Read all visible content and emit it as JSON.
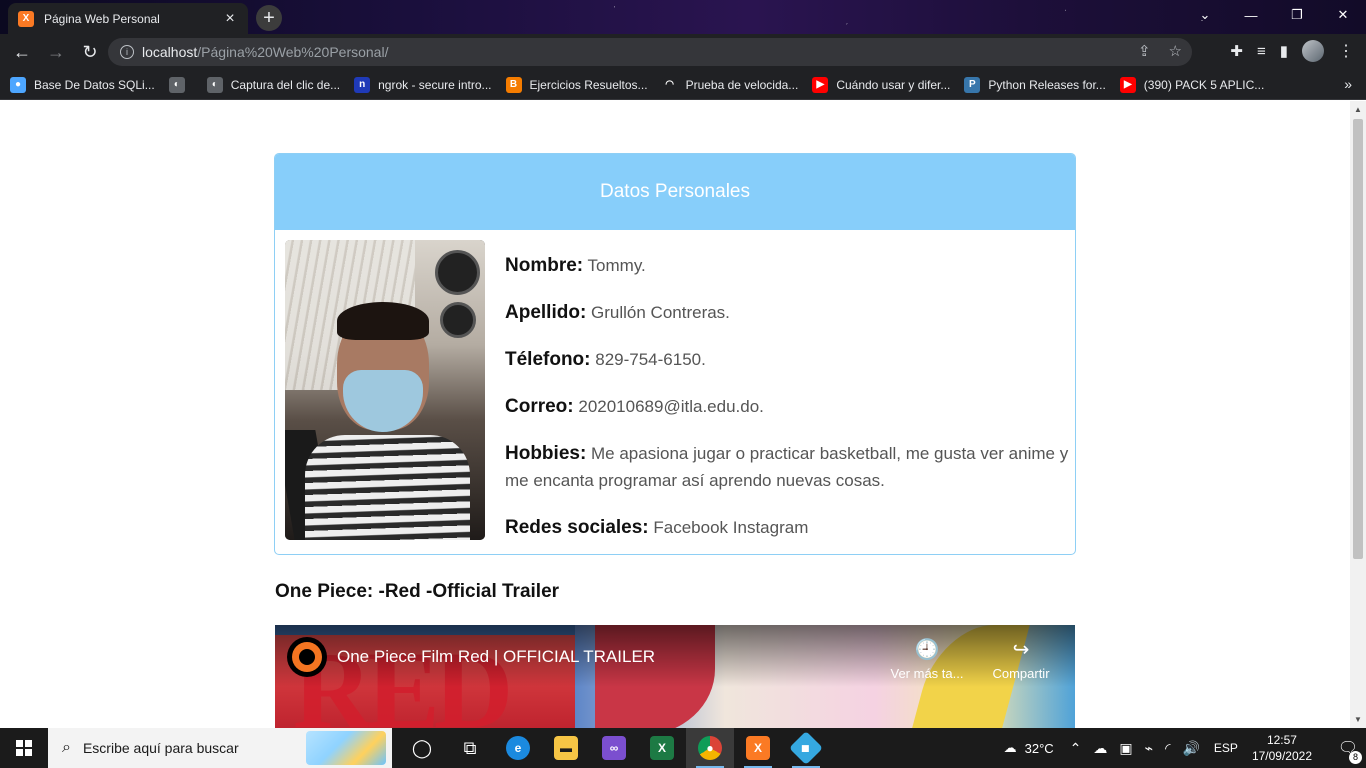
{
  "browser": {
    "tab_title": "Página Web Personal",
    "tab_favicon_label": "X",
    "url_host": "localhost",
    "url_path": "/Página%20Web%20Personal/"
  },
  "bookmarks": [
    {
      "label": "Base De Datos SQLi...",
      "color": "#4da6ff",
      "glyph": "●"
    },
    {
      "label": "",
      "color": "#5f6368",
      "glyph": "◐"
    },
    {
      "label": "Captura del clic de...",
      "color": "#5f6368",
      "glyph": "◐"
    },
    {
      "label": "ngrok - secure intro...",
      "color": "#1f3ab8",
      "glyph": "n"
    },
    {
      "label": "Ejercicios Resueltos...",
      "color": "#f57c00",
      "glyph": "B"
    },
    {
      "label": "Prueba de velocida...",
      "color": "#202124",
      "glyph": "◠"
    },
    {
      "label": "Cuándo usar y difer...",
      "color": "#ff0000",
      "glyph": "▶"
    },
    {
      "label": "Python Releases for...",
      "color": "#3776ab",
      "glyph": "P"
    },
    {
      "label": "(390) PACK 5 APLIC...",
      "color": "#ff0000",
      "glyph": "▶"
    }
  ],
  "card": {
    "header": "Datos Personales",
    "fields": {
      "nombre_label": "Nombre:",
      "nombre_value": "Tommy.",
      "apellido_label": "Apellido:",
      "apellido_value": "Grullón Contreras.",
      "telefono_label": "Télefono:",
      "telefono_value": "829-754-6150.",
      "correo_label": "Correo:",
      "correo_value": "202010689@itla.edu.do.",
      "hobbies_label": "Hobbies:",
      "hobbies_value": "Me apasiona jugar o practicar basketball, me gusta ver anime y me encanta programar así aprendo nuevas cosas.",
      "redes_label": "Redes sociales:",
      "redes_facebook": "Facebook",
      "redes_instagram": "Instagram"
    }
  },
  "video_section": {
    "heading": "One Piece: -Red -Official Trailer",
    "video_title": "One Piece Film Red | OFFICIAL TRAILER",
    "watch_later_label": "Ver más ta...",
    "share_label": "Compartir",
    "art_text": "RED"
  },
  "taskbar": {
    "search_placeholder": "Escribe aquí para buscar",
    "temperature": "32°C",
    "language": "ESP",
    "time": "12:57",
    "date": "17/09/2022",
    "notification_count": "8"
  }
}
